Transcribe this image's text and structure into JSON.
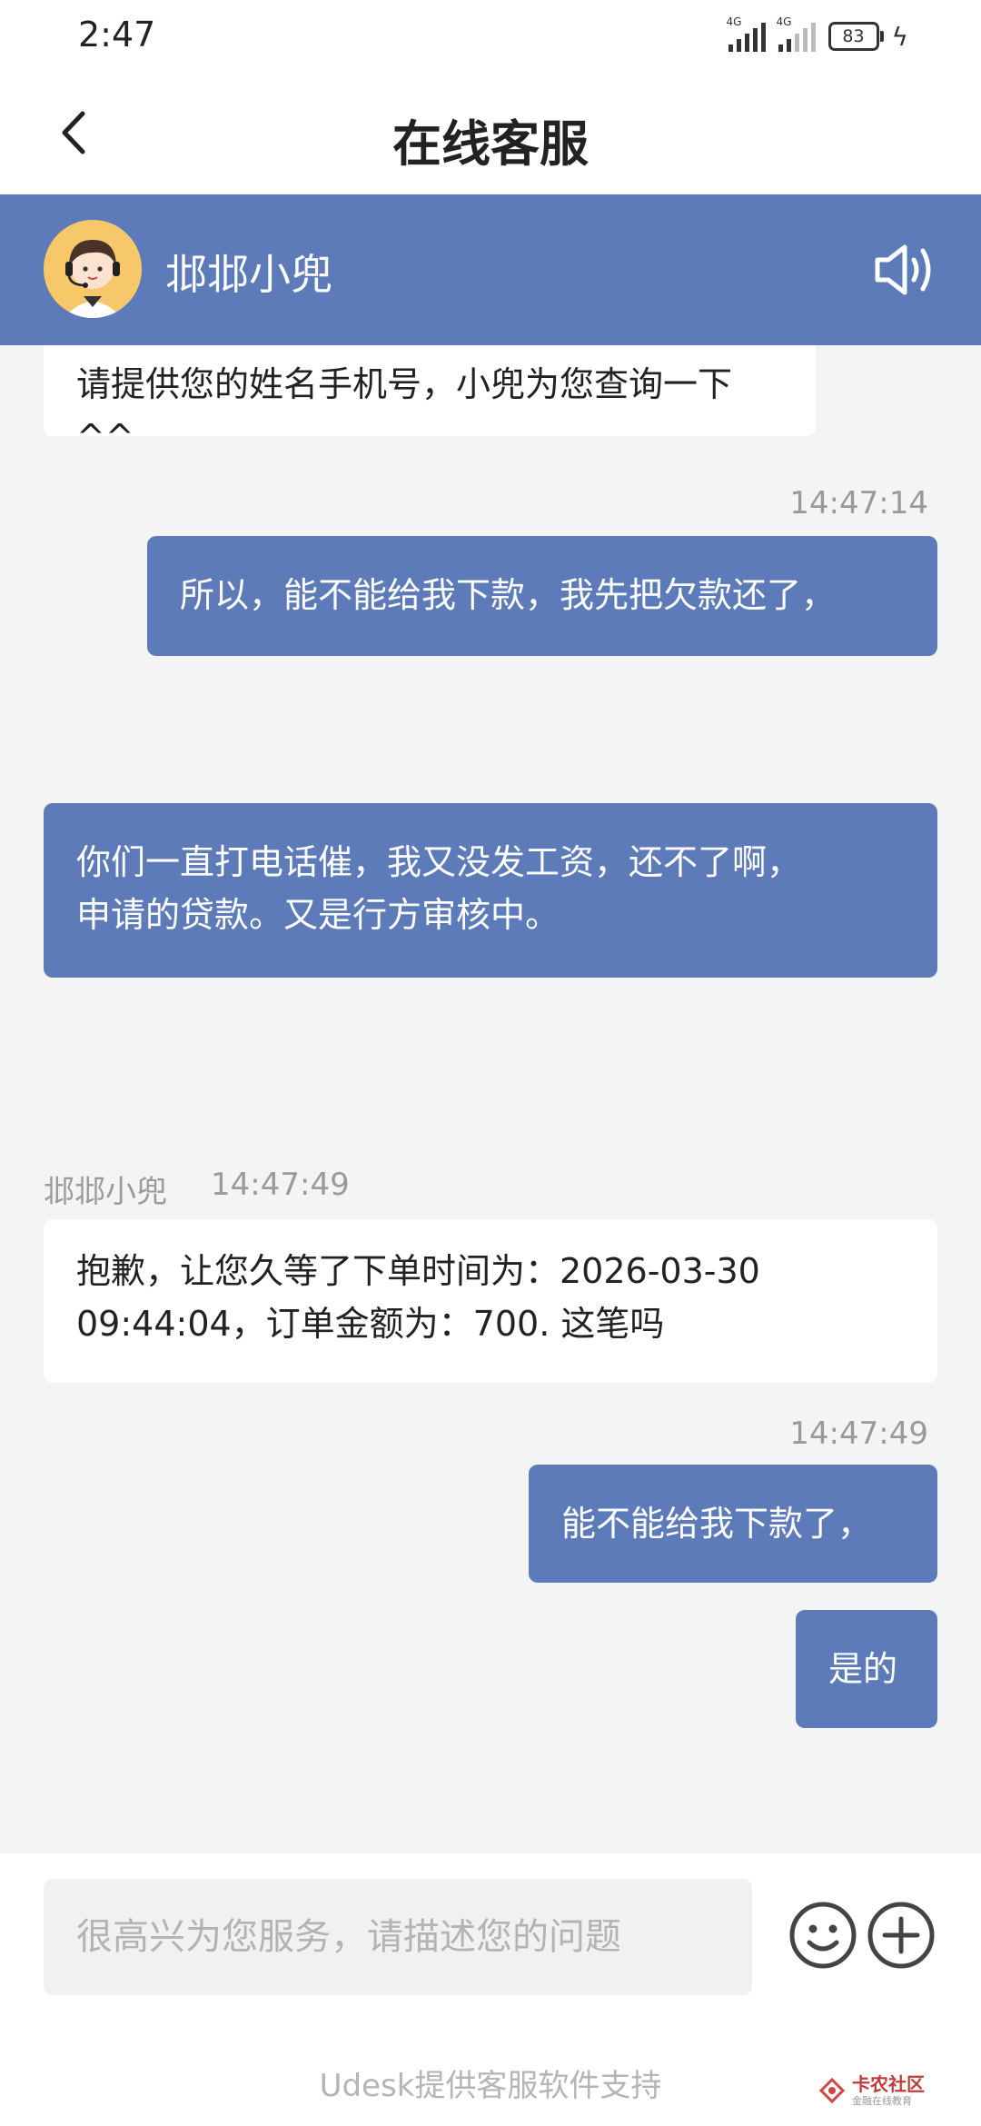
{
  "status_bar": {
    "time": "2:47",
    "signal1_label": "4G",
    "signal2_label": "4G",
    "battery": "83"
  },
  "nav": {
    "title": "在线客服"
  },
  "agent": {
    "name": "邶邶小兜"
  },
  "messages": {
    "agent_msg_1": "请提供您的姓名手机号，小兜为您查询一下^^",
    "ts_1": "14:47:14",
    "user_msg_1": "所以，能不能给我下款，我先把欠款还了，",
    "user_msg_2_line1": "你们一直打电话催，我又没发工资，还不了啊，",
    "user_msg_2_line2": "申请的贷款。又是行方审核中。",
    "agent_label": "邶邶小兜",
    "ts_2": "14:47:49",
    "agent_msg_2_line1": "抱歉，让您久等了下单时间为：2026-03-30",
    "agent_msg_2_line2": "09:44:04，订单金额为：700. 这笔吗",
    "ts_3": "14:47:49",
    "user_msg_3": "能不能给我下款了，",
    "user_msg_4": "是的"
  },
  "input": {
    "placeholder": "很高兴为您服务，请描述您的问题"
  },
  "footer": {
    "powered_by": "Udesk提供客服软件支持",
    "watermark_main": "卡农社区",
    "watermark_sub": "金融在线教育"
  },
  "colors": {
    "accent": "#5d7bb8",
    "background": "#f4f4f4"
  }
}
